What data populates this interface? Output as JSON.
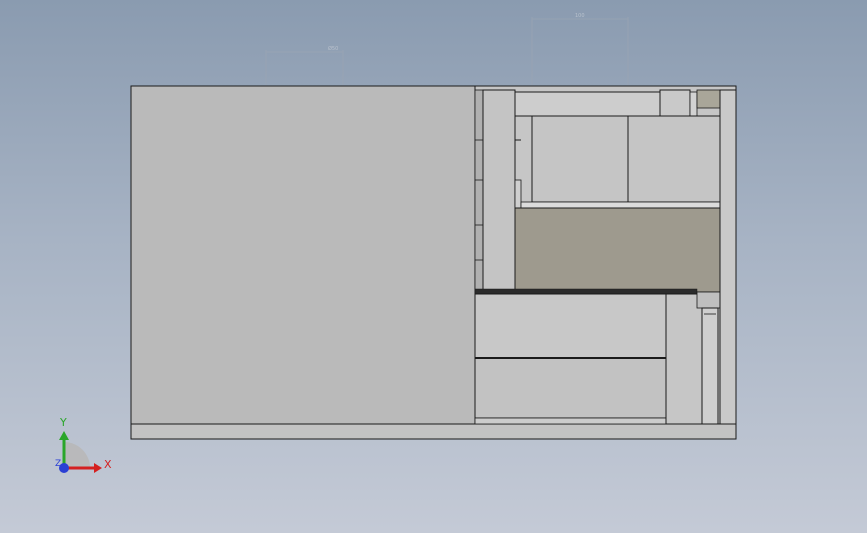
{
  "view": {
    "background_top": "#8a9bb0",
    "background_bottom": "#c4cad6"
  },
  "dimensions": [
    {
      "label": "Ø50"
    },
    {
      "label": "100"
    }
  ],
  "model": {
    "panel_color": "#bdbdbd",
    "face_color": "#c8c8c8",
    "dark_face_color": "#9e9a8e",
    "edge_color": "#1a1a1a"
  },
  "triad": {
    "x_label": "X",
    "y_label": "Y",
    "z_label": "Z",
    "x_color": "#d42020",
    "y_color": "#2aa62a",
    "z_color": "#2a3fd4"
  }
}
